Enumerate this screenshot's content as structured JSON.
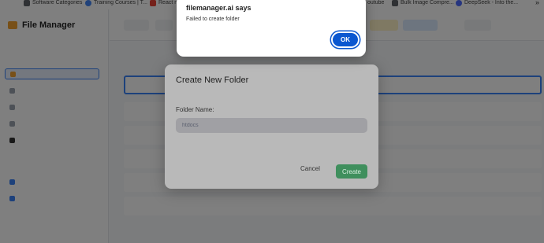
{
  "bookmarks": {
    "items": [
      {
        "label": "Software Categories",
        "color": "#5f6368"
      },
      {
        "label": "Training Courses | T...",
        "color": "#4285f4"
      },
      {
        "label": "React n",
        "color": "#ea4335"
      },
      {
        "label": "outube",
        "color": "#ea4335"
      },
      {
        "label": "Bulk Image Compre...",
        "color": "#5f6368"
      },
      {
        "label": "DeepSeek - Into the...",
        "color": "#4d6bfe"
      }
    ],
    "more": "»"
  },
  "app": {
    "title": "File Manager",
    "toolbar": {
      "b1": "",
      "b2": "",
      "b3": "",
      "b4": "",
      "b5": ""
    },
    "rows": [
      {
        "date": ""
      },
      {
        "date": ""
      },
      {
        "date": ""
      },
      {
        "date": ""
      },
      {
        "date": ""
      },
      {
        "date": ""
      }
    ]
  },
  "modal": {
    "title": "Create New Folder",
    "field_label": "Folder Name:",
    "input_value": "",
    "input_placeholder": "htdocs",
    "cancel_label": "Cancel",
    "create_label": "Create"
  },
  "alert": {
    "title": "filemanager.ai says",
    "message": "Failed to create folder",
    "ok_label": "OK"
  }
}
